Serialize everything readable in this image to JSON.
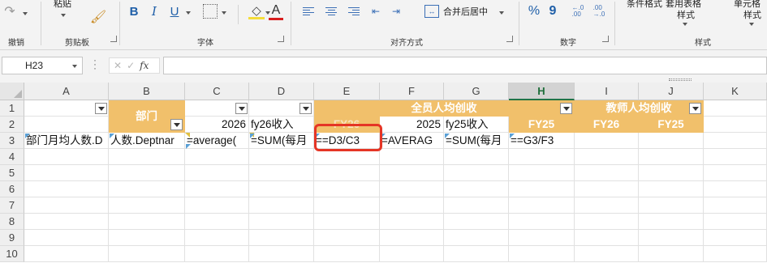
{
  "ribbon": {
    "groups": {
      "undo": "撤销",
      "clipboard": "剪贴板",
      "font": "字体",
      "alignment": "对齐方式",
      "number": "数字",
      "styles": "样式"
    },
    "paste_label": "粘贴",
    "merge_label": "合并后居中",
    "cond_format_label": "条件格式",
    "table_format_line1": "套用表格",
    "table_format_line2": "样式",
    "cell_style_line1": "单元格",
    "cell_style_line2": "样式",
    "bold": "B",
    "italic": "I",
    "underline": "U",
    "font_color": "A",
    "percent": "%",
    "comma": "9"
  },
  "formula_bar": {
    "name_box": "H23",
    "fx_label": "fx",
    "cancel": "✕",
    "confirm": "✓",
    "formula": ""
  },
  "sheet": {
    "columns": [
      "A",
      "B",
      "C",
      "D",
      "E",
      "F",
      "G",
      "H",
      "I",
      "J",
      "K"
    ],
    "rows": [
      "1",
      "2",
      "3",
      "4",
      "5",
      "6",
      "7",
      "8",
      "9",
      "10"
    ],
    "selected_column": "H",
    "cells": {
      "B1": "部门",
      "E1": "全员人均创收",
      "I1": "教师人均创收",
      "C2": "2026",
      "D2": "fy26收入",
      "E2": "FY26",
      "F2": "2025",
      "G2": "fy25收入",
      "H2": "FY25",
      "I2": "FY26",
      "J2": "FY25",
      "A3": "部门月均人数.D",
      "B3": "人数.Deptnar",
      "C3": "=average(",
      "D3": "=SUM(每月",
      "E3": "==D3/C3",
      "F3": "=AVERAG",
      "G3": "=SUM(每月",
      "H3": "==G3/F3"
    }
  },
  "colors": {
    "header_fill": "#F1C06B",
    "highlight_box": "#E53525",
    "selected_column": "#217346"
  }
}
